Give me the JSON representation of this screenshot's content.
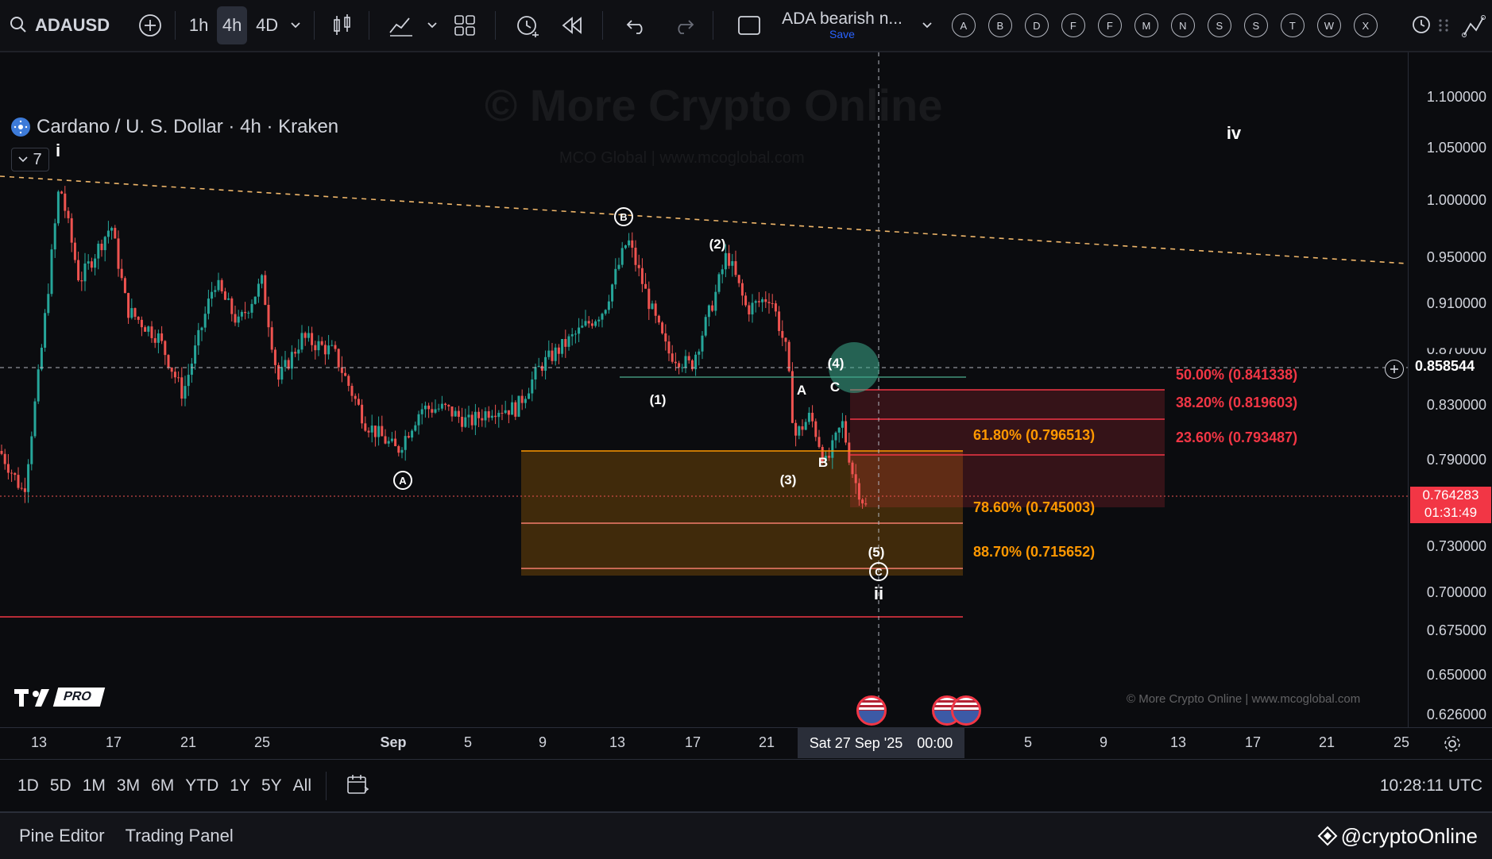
{
  "toolbar": {
    "symbol": "ADAUSD",
    "timeframes": [
      "1h",
      "4h",
      "4D"
    ],
    "active_timeframe": "4h",
    "layout_name": "ADA bearish n...",
    "save_label": "Save",
    "alert_letters": [
      "A",
      "B",
      "D",
      "F",
      "F",
      "M",
      "N",
      "S",
      "S",
      "T",
      "W",
      "X"
    ]
  },
  "legend": {
    "title": "Cardano / U. S. Dollar · 4h · Kraken",
    "indicator_count": "7"
  },
  "watermark": {
    "main": "© More Crypto Online",
    "sub": "MCO Global   |   www.mcoglobal.com",
    "footer": "© More Crypto Online  |  www.mcoglobal.com"
  },
  "price_axis": {
    "labels": [
      "1.100000",
      "1.050000",
      "1.000000",
      "0.950000",
      "0.910000",
      "0.870000",
      "0.830000",
      "0.790000",
      "0.730000",
      "0.700000",
      "0.675000",
      "0.650000",
      "0.626000"
    ],
    "crosshair_price": "0.858544",
    "last_price": "0.764283",
    "countdown": "01:31:49"
  },
  "time_axis": {
    "labels": [
      "13",
      "17",
      "21",
      "25",
      "Sep",
      "5",
      "9",
      "13",
      "17",
      "21",
      "5",
      "9",
      "13",
      "17",
      "21",
      "25"
    ],
    "crosshair_time": "Sat 27 Sep '25",
    "crosshair_hour": "00:00"
  },
  "wave_labels": [
    "i",
    "(1)",
    "(2)",
    "(3)",
    "(4)",
    "(5)",
    "A",
    "B",
    "C",
    "ii",
    "iv"
  ],
  "circled_labels": [
    "A",
    "B",
    "C"
  ],
  "fib_levels": [
    {
      "label": "50.00% (0.841338)",
      "color": "#f23645"
    },
    {
      "label": "38.20% (0.819603)",
      "color": "#f23645"
    },
    {
      "label": "23.60% (0.793487)",
      "color": "#f23645"
    },
    {
      "label": "61.80% (0.796513)",
      "color": "#ff9800"
    },
    {
      "label": "78.60% (0.745003)",
      "color": "#ff9800"
    },
    {
      "label": "88.70% (0.715652)",
      "color": "#ff9800"
    }
  ],
  "brand": {
    "logo_text": "PRO"
  },
  "ranges": [
    "1D",
    "5D",
    "1M",
    "3M",
    "6M",
    "YTD",
    "1Y",
    "5Y",
    "All"
  ],
  "clock": "10:28:11 UTC",
  "panels": [
    "Pine Editor",
    "Trading Panel"
  ],
  "footer_brand": "@cryptoOnline",
  "colors": {
    "up": "#26a69a",
    "down": "#ef5350",
    "fib_red": "#f23645",
    "fib_orange": "#ff9800",
    "trend": "#f0b76a"
  }
}
